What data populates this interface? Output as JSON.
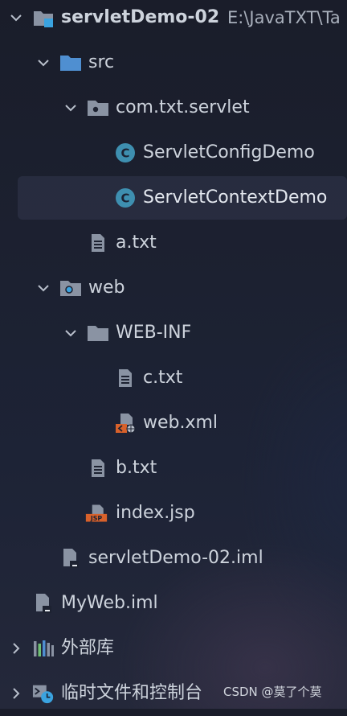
{
  "tree": {
    "project": {
      "name": "servletDemo-02",
      "path": "E:\\JavaTXT\\Ta"
    },
    "src": {
      "label": "src"
    },
    "package": {
      "label": "com.txt.servlet"
    },
    "class_config": {
      "label": "ServletConfigDemo"
    },
    "class_context": {
      "label": "ServletContextDemo"
    },
    "file_a": {
      "label": "a.txt"
    },
    "web": {
      "label": "web"
    },
    "webinf": {
      "label": "WEB-INF"
    },
    "file_c": {
      "label": "c.txt"
    },
    "web_xml": {
      "label": "web.xml"
    },
    "file_b": {
      "label": "b.txt"
    },
    "index_jsp": {
      "label": "index.jsp"
    },
    "iml": {
      "label": "servletDemo-02.iml"
    },
    "myweb_iml": {
      "label": "MyWeb.iml"
    },
    "ext_libs": {
      "label": "外部库"
    },
    "scratches": {
      "label": "临时文件和控制台"
    }
  },
  "watermark": "CSDN @莫了个莫",
  "colors": {
    "background": "#1c2131",
    "selection": "#2c3146",
    "folder_blue": "#4f8fd1",
    "folder_grey": "#8a93a3",
    "class_badge": "#3e8fb0",
    "xml_orange": "#d8612b",
    "jsp_orange": "#d8612b",
    "text": "#cdd3dc"
  },
  "icons": {
    "project": "module-folder-icon",
    "src": "source-folder-icon",
    "package": "package-icon",
    "class": "java-class-icon",
    "text_file": "text-file-icon",
    "web": "web-folder-icon",
    "folder": "folder-icon",
    "xml": "xml-file-icon",
    "jsp": "jsp-file-icon",
    "iml": "iml-file-icon",
    "libraries": "libraries-icon",
    "scratches": "scratches-console-icon"
  }
}
